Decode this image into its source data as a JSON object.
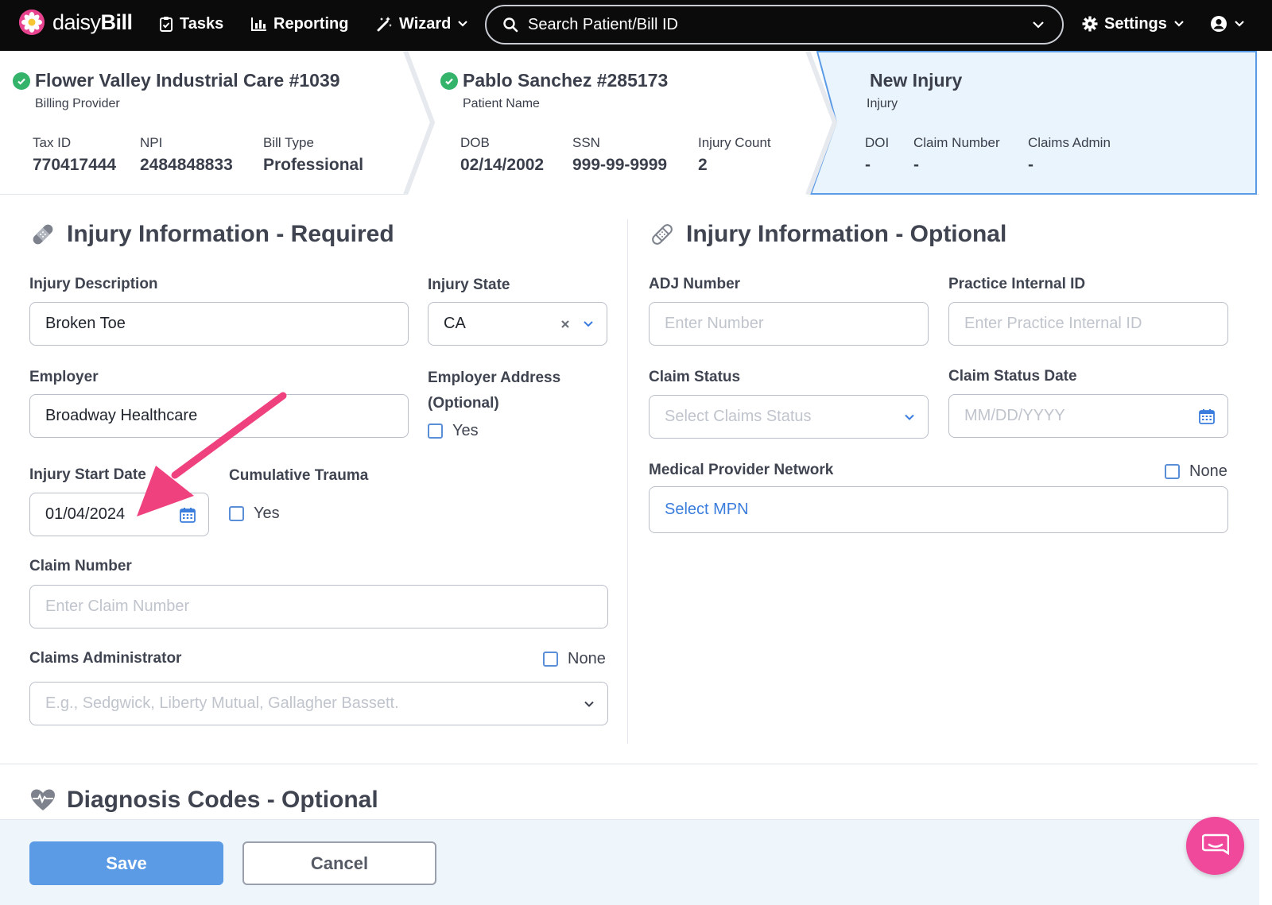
{
  "nav": {
    "logo_prefix": "daisy",
    "logo_bold": "Bill",
    "tasks": "Tasks",
    "reporting": "Reporting",
    "wizard": "Wizard",
    "search_placeholder": "Search Patient/Bill ID",
    "settings": "Settings"
  },
  "crumbs": {
    "provider": {
      "title": "Flower Valley Industrial Care #1039",
      "subtitle": "Billing Provider",
      "tax_id_label": "Tax ID",
      "tax_id": "770417444",
      "npi_label": "NPI",
      "npi": "2484848833",
      "bill_type_label": "Bill Type",
      "bill_type": "Professional"
    },
    "patient": {
      "title": "Pablo Sanchez #285173",
      "subtitle": "Patient Name",
      "dob_label": "DOB",
      "dob": "02/14/2002",
      "ssn_label": "SSN",
      "ssn": "999-99-9999",
      "injury_count_label": "Injury Count",
      "injury_count": "2"
    },
    "injury": {
      "title": "New Injury",
      "subtitle": "Injury",
      "doi_label": "DOI",
      "doi": "-",
      "claim_number_label": "Claim Number",
      "claim_number": "-",
      "claims_admin_label": "Claims Admin",
      "claims_admin": "-"
    }
  },
  "required": {
    "title": "Injury Information - Required",
    "injury_description_label": "Injury Description",
    "injury_description": "Broken Toe",
    "injury_state_label": "Injury State",
    "injury_state": "CA",
    "employer_label": "Employer",
    "employer": "Broadway Healthcare",
    "employer_address_label_1": "Employer Address",
    "employer_address_label_2": "(Optional)",
    "employer_address_yes": "Yes",
    "injury_start_date_label": "Injury Start Date",
    "injury_start_date": "01/04/2024",
    "cumulative_trauma_label": "Cumulative Trauma",
    "cumulative_trauma_yes": "Yes",
    "claim_number_label": "Claim Number",
    "claim_number_placeholder": "Enter Claim Number",
    "claims_admin_label": "Claims Administrator",
    "claims_admin_none": "None",
    "claims_admin_placeholder": "E.g., Sedgwick, Liberty Mutual, Gallagher Bassett."
  },
  "optional": {
    "title": "Injury Information - Optional",
    "adj_label": "ADJ Number",
    "adj_placeholder": "Enter Number",
    "internal_id_label": "Practice Internal ID",
    "internal_id_placeholder": "Enter Practice Internal ID",
    "claim_status_label": "Claim Status",
    "claim_status_placeholder": "Select Claims Status",
    "claim_status_date_label": "Claim Status Date",
    "claim_status_date_placeholder": "MM/DD/YYYY",
    "mpn_label": "Medical Provider Network",
    "mpn_none": "None",
    "mpn_select": "Select MPN"
  },
  "diagnosis": {
    "title": "Diagnosis Codes - Optional"
  },
  "footer": {
    "save": "Save",
    "cancel": "Cancel"
  },
  "colors": {
    "accent": "#5b9be6",
    "brand_pink": "#e8438e",
    "check_green": "#34b36b",
    "arrow": "#f0417f",
    "link": "#3b7ddd"
  }
}
